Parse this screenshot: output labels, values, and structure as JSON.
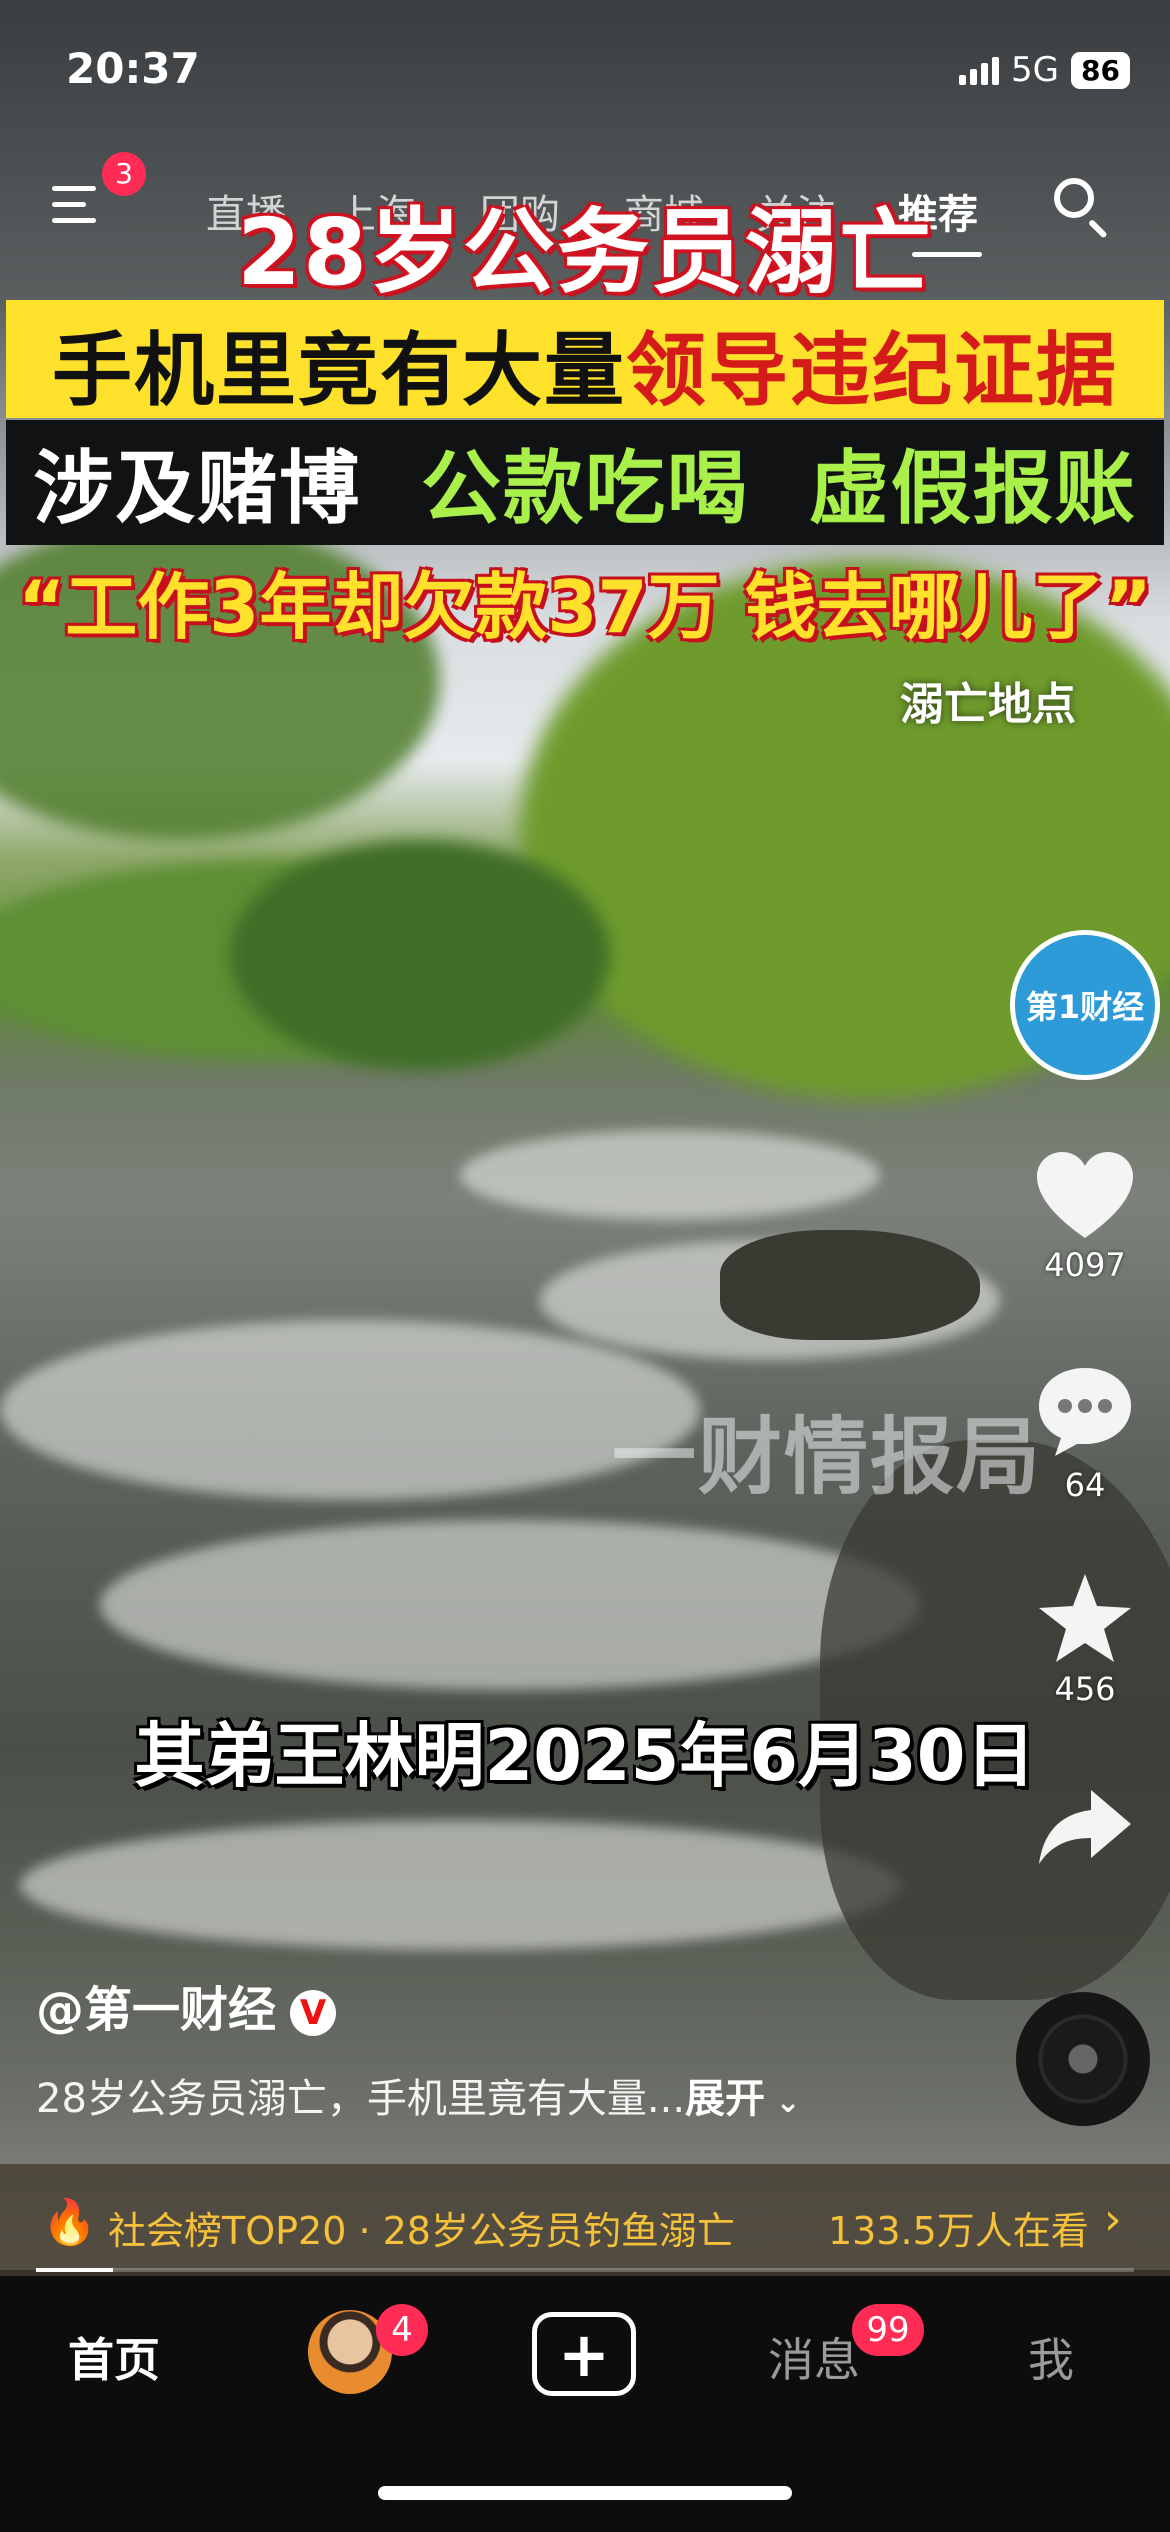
{
  "status_bar": {
    "time": "20:37",
    "network": "5G",
    "battery": "86"
  },
  "top_nav": {
    "menu_badge": "3",
    "tabs": [
      "直播",
      "上海",
      "团购",
      "商城",
      "关注",
      "推荐"
    ]
  },
  "video": {
    "headline_1": "28岁公务员溺亡",
    "headline_2_black": "手机里竟有大量",
    "headline_2_red": "领导违纪证据",
    "headline_3_white": "涉及赌博",
    "headline_3_a": "公款吃喝",
    "headline_3_b": "虚假报账",
    "headline_4": "“工作3年却欠款37万  钱去哪儿了”",
    "place_label": "溺亡地点",
    "watermark": "一财情报局",
    "date_caption": "其弟王林明2025年6月30日"
  },
  "right_rail": {
    "channel_logo_text": "第1财经",
    "likes": "4097",
    "comments": "64",
    "favorites": "456"
  },
  "caption": {
    "author": "@第一财经",
    "verified": "V",
    "description": "28岁公务员溺亡，手机里竟有大量...",
    "expand": "展开"
  },
  "hot_bar": {
    "text": "社会榜TOP20 · 28岁公务员钓鱼溺亡",
    "viewers": "133.5万人在看"
  },
  "progress": 0.07,
  "tab_bar": {
    "home": "首页",
    "friends_badge": "4",
    "messages": "消息",
    "messages_badge": "99",
    "me": "我"
  },
  "colors": {
    "accent_red": "#ff2c55",
    "hot_yellow": "#f6c13a",
    "logo_blue": "#2c9bd8"
  }
}
